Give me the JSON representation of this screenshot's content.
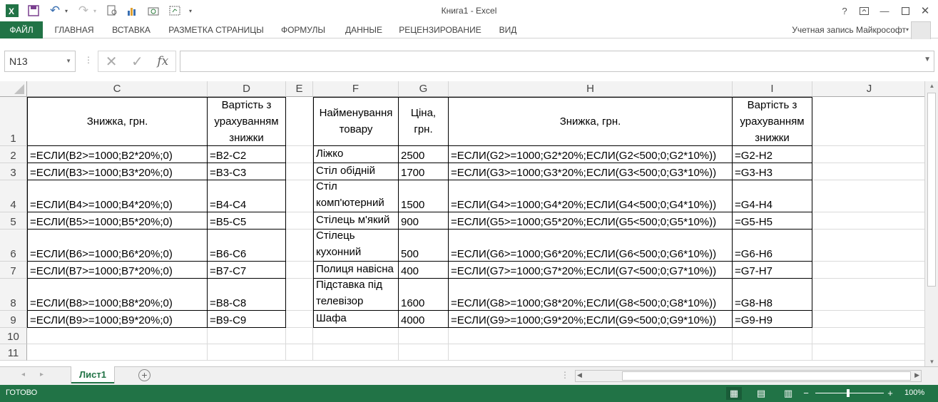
{
  "app": {
    "title": "Книга1 - Excel"
  },
  "ribbon": {
    "tabs": [
      "ФАЙЛ",
      "ГЛАВНАЯ",
      "ВСТАВКА",
      "РАЗМЕТКА СТРАНИЦЫ",
      "ФОРМУЛЫ",
      "ДАННЫЕ",
      "РЕЦЕНЗИРОВАНИЕ",
      "ВИД"
    ],
    "account": "Учетная запись Майкрософт"
  },
  "formula_bar": {
    "name_box": "N13",
    "fx_label": "fx",
    "value": ""
  },
  "columns": [
    "C",
    "D",
    "E",
    "F",
    "G",
    "H",
    "I",
    "J"
  ],
  "rows": [
    "1",
    "2",
    "3",
    "4",
    "5",
    "6",
    "7",
    "8",
    "9",
    "10",
    "11"
  ],
  "header_row": {
    "C": "Знижка, грн.",
    "D": "Вартість з урахуванням знижки",
    "F": "Найменування товару",
    "G": "Ціна, грн.",
    "H": "Знижка, грн.",
    "I": "Вартість з урахуванням знижки"
  },
  "data_rows": [
    {
      "C": "=ЕСЛИ(B2>=1000;B2*20%;0)",
      "D": "=B2-C2",
      "F": "Ліжко",
      "G": "2500",
      "H": "=ЕСЛИ(G2>=1000;G2*20%;ЕСЛИ(G2<500;0;G2*10%))",
      "I": "=G2-H2"
    },
    {
      "C": "=ЕСЛИ(B3>=1000;B3*20%;0)",
      "D": "=B3-C3",
      "F": "Стіл обідній",
      "G": "1700",
      "H": "=ЕСЛИ(G3>=1000;G3*20%;ЕСЛИ(G3<500;0;G3*10%))",
      "I": "=G3-H3"
    },
    {
      "C": "=ЕСЛИ(B4>=1000;B4*20%;0)",
      "D": "=B4-C4",
      "F": "Стіл комп'ютерний",
      "G": "1500",
      "H": "=ЕСЛИ(G4>=1000;G4*20%;ЕСЛИ(G4<500;0;G4*10%))",
      "I": "=G4-H4"
    },
    {
      "C": "=ЕСЛИ(B5>=1000;B5*20%;0)",
      "D": "=B5-C5",
      "F": "Стілець м'який",
      "G": "900",
      "H": "=ЕСЛИ(G5>=1000;G5*20%;ЕСЛИ(G5<500;0;G5*10%))",
      "I": "=G5-H5"
    },
    {
      "C": "=ЕСЛИ(B6>=1000;B6*20%;0)",
      "D": "=B6-C6",
      "F": "Стілець кухонний",
      "G": "500",
      "H": "=ЕСЛИ(G6>=1000;G6*20%;ЕСЛИ(G6<500;0;G6*10%))",
      "I": "=G6-H6"
    },
    {
      "C": "=ЕСЛИ(B7>=1000;B7*20%;0)",
      "D": "=B7-C7",
      "F": "Полиця навісна",
      "G": "400",
      "H": "=ЕСЛИ(G7>=1000;G7*20%;ЕСЛИ(G7<500;0;G7*10%))",
      "I": "=G7-H7"
    },
    {
      "C": "=ЕСЛИ(B8>=1000;B8*20%;0)",
      "D": "=B8-C8",
      "F": "Підставка під телевізор",
      "G": "1600",
      "H": "=ЕСЛИ(G8>=1000;G8*20%;ЕСЛИ(G8<500;0;G8*10%))",
      "I": "=G8-H8"
    },
    {
      "C": "=ЕСЛИ(B9>=1000;B9*20%;0)",
      "D": "=B9-C9",
      "F": "Шафа",
      "G": "4000",
      "H": "=ЕСЛИ(G9>=1000;G9*20%;ЕСЛИ(G9<500;0;G9*10%))",
      "I": "=G9-H9"
    }
  ],
  "sheets": {
    "active": "Лист1",
    "add_label": "+"
  },
  "status": {
    "text": "ГОТОВО",
    "zoom": "100%"
  },
  "colors": {
    "accent": "#217346"
  }
}
